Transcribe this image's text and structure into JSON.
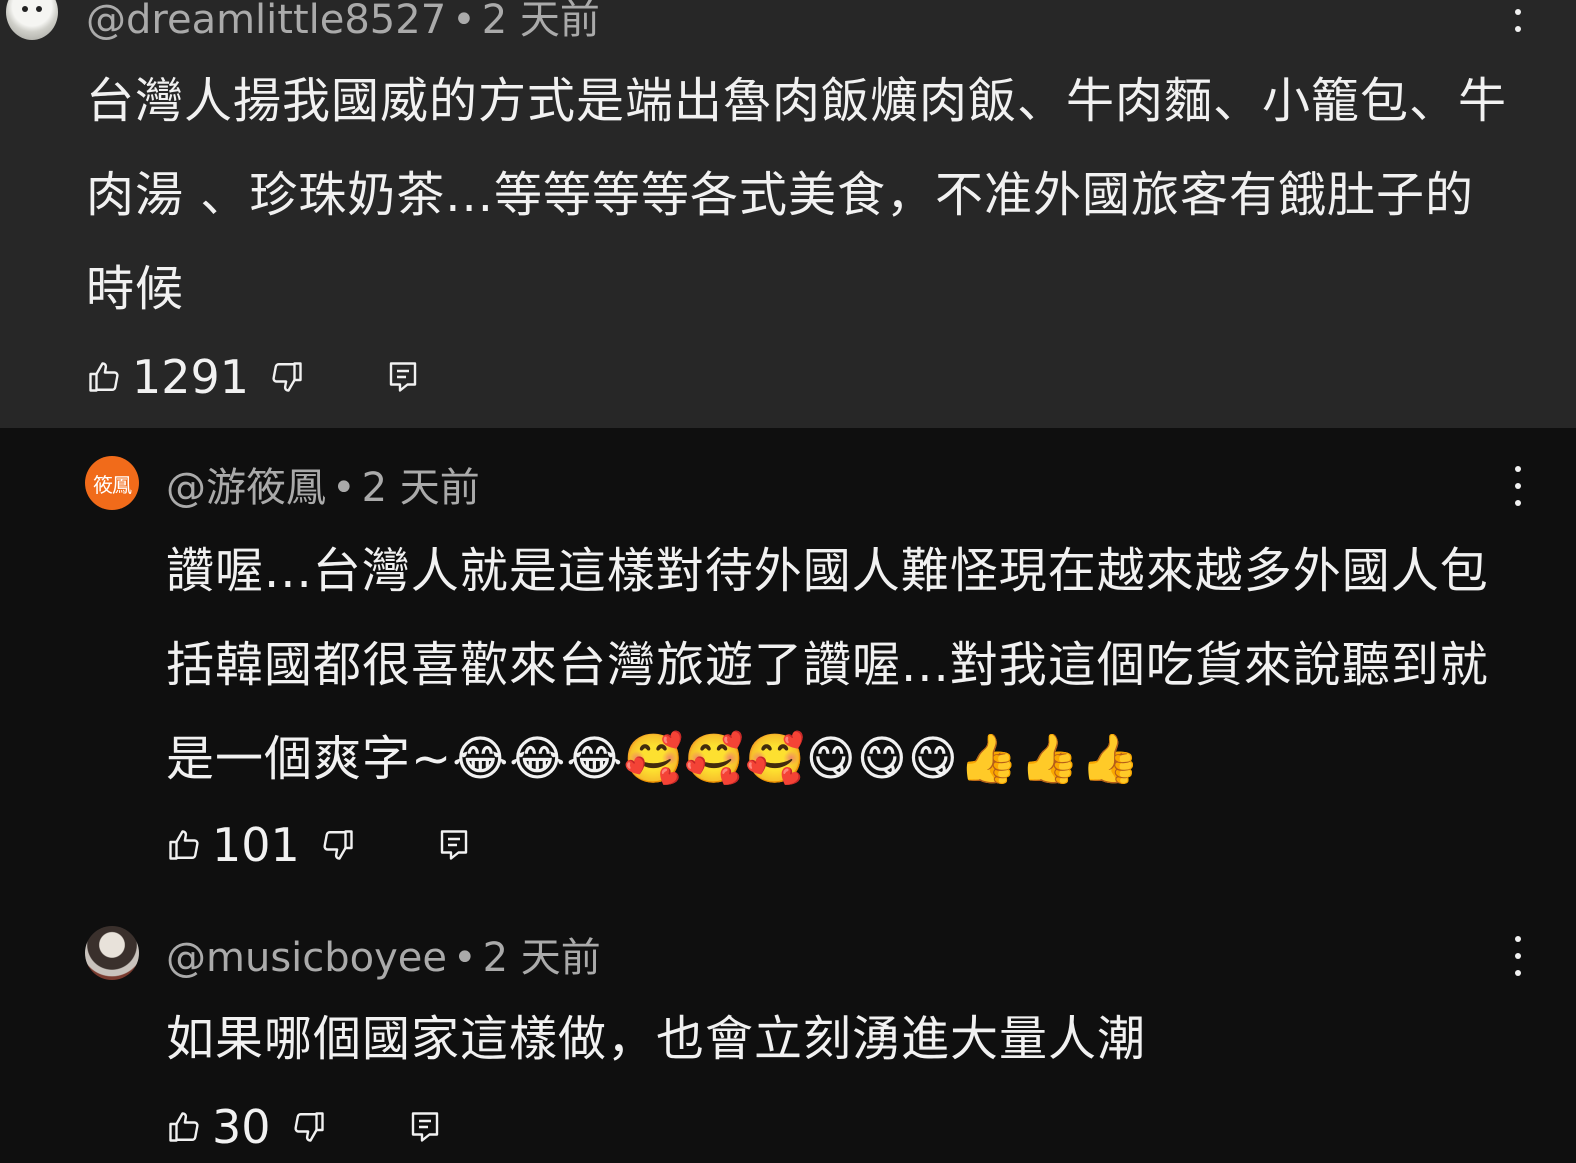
{
  "comments": [
    {
      "handle": "@dreamlittle8527",
      "time": "2 天前",
      "text": "台灣人揚我國威的方式是端出魯肉飯爌肉飯、牛肉麵、小籠包、牛肉湯 、珍珠奶茶...等等等等各式美食，不准外國旅客有餓肚子的時候",
      "likes": "1291"
    },
    {
      "handle": "@游筱鳳",
      "avatar_text": "筱鳳",
      "time": "2 天前",
      "text": "讚喔...台灣人就是這樣對待外國人難怪現在越來越多外國人包括韓國都很喜歡來台灣旅遊了讚喔...對我這個吃貨來說聽到就是一個爽字~😂😂😂🥰🥰🥰😋😋😋👍👍👍",
      "likes": "101"
    },
    {
      "handle": "@musicboyee",
      "time": "2 天前",
      "text": "如果哪個國家這樣做，也會立刻湧進大量人潮",
      "likes": "30"
    }
  ],
  "separator": "•",
  "colors": {
    "highlight_bg": "#272727",
    "page_bg": "#0f0f0f",
    "avatar_orange": "#f16b1a"
  },
  "icons": {
    "like": "thumbs-up-icon",
    "dislike": "thumbs-down-icon",
    "reply": "reply-icon",
    "menu": "more-vertical-icon"
  }
}
